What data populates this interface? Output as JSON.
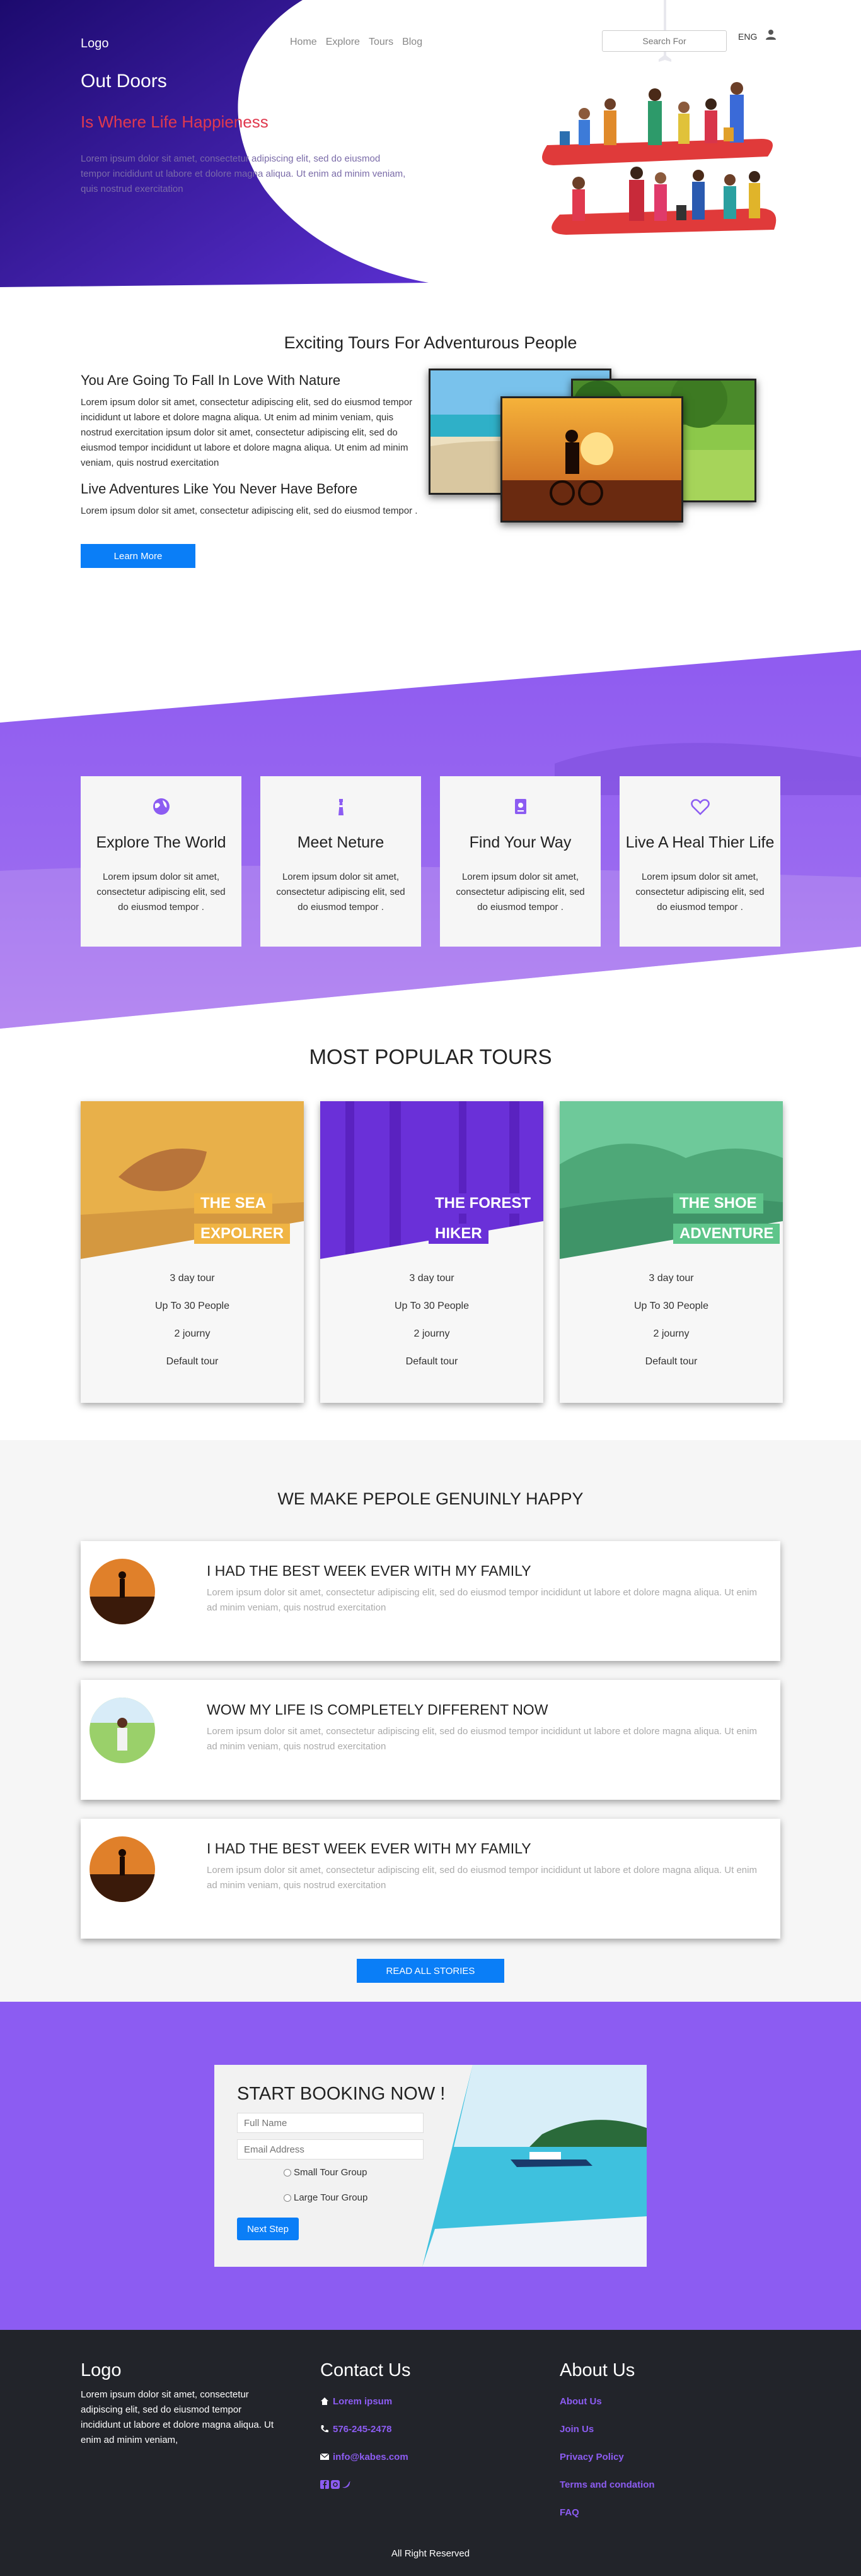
{
  "header": {
    "logo": "Logo",
    "nav": [
      "Home",
      "Explore",
      "Tours",
      "Blog"
    ],
    "search_placeholder": "Search For",
    "language": "ENG",
    "title": "Out Doors",
    "subtitle": "Is Where Life Happieness",
    "description": "Lorem ipsum dolor sit amet, consectetur adipiscing elit, sed do eiusmod tempor incididunt ut labore et dolore magna aliqua. Ut enim ad minim veniam, quis nostrud exercitation"
  },
  "about": {
    "heading": "Exciting Tours For Adventurous People",
    "h1": "You Are Going To Fall In Love With Nature",
    "p1": "Lorem ipsum dolor sit amet, consectetur adipiscing elit, sed do eiusmod tempor incididunt ut labore et dolore magna aliqua. Ut enim ad minim veniam, quis nostrud exercitation ipsum dolor sit amet, consectetur adipiscing elit, sed do eiusmod tempor incididunt ut labore et dolore magna aliqua. Ut enim ad minim veniam, quis nostrud exercitation",
    "h2": "Live Adventures Like You Never Have Before",
    "p2": "Lorem ipsum dolor sit amet, consectetur adipiscing elit, sed do eiusmod tempor .",
    "button": "Learn More"
  },
  "features": [
    {
      "icon": "globe-icon",
      "title": "Explore The World",
      "text": "Lorem ipsum dolor sit amet, consectetur adipiscing elit, sed do eiusmod tempor ."
    },
    {
      "icon": "lighthouse-icon",
      "title": "Meet Neture",
      "text": "Lorem ipsum dolor sit amet, consectetur adipiscing elit, sed do eiusmod tempor ."
    },
    {
      "icon": "map-book-icon",
      "title": "Find Your Way",
      "text": "Lorem ipsum dolor sit amet, consectetur adipiscing elit, sed do eiusmod tempor ."
    },
    {
      "icon": "heart-icon",
      "title": "Live A Heal Thier Life",
      "text": "Lorem ipsum dolor sit amet, consectetur adipiscing elit, sed do eiusmod tempor ."
    }
  ],
  "tours": {
    "heading": "MOST POPULAR TOURS",
    "items": [
      {
        "line1": "THE SEA",
        "line2": "EXPOLRER",
        "color": "#f0b443",
        "days": "3 day tour",
        "people": "Up To 30 People",
        "journey": "2 journy",
        "type": "Default tour"
      },
      {
        "line1": "THE FOREST",
        "line2": "HIKER",
        "color": "#6a30d8",
        "days": "3 day tour",
        "people": "Up To 30 People",
        "journey": "2 journy",
        "type": "Default tour"
      },
      {
        "line1": "THE SHOE",
        "line2": "ADVENTURE",
        "color": "#5ec58a",
        "days": "3 day tour",
        "people": "Up To 30 People",
        "journey": "2 journy",
        "type": "Default tour"
      }
    ]
  },
  "stories": {
    "heading": "WE MAKE PEPOLE GENUINLY HAPPY",
    "items": [
      {
        "title": "I HAD THE BEST WEEK EVER WITH MY FAMILY",
        "text": "Lorem ipsum dolor sit amet, consectetur adipiscing elit, sed do eiusmod tempor incididunt ut labore et dolore magna aliqua. Ut enim ad minim veniam, quis nostrud exercitation"
      },
      {
        "title": "WOW MY LIFE IS COMPLETELY DIFFERENT NOW",
        "text": "Lorem ipsum dolor sit amet, consectetur adipiscing elit, sed do eiusmod tempor incididunt ut labore et dolore magna aliqua. Ut enim ad minim veniam, quis nostrud exercitation"
      },
      {
        "title": "I HAD THE BEST WEEK EVER WITH MY FAMILY",
        "text": "Lorem ipsum dolor sit amet, consectetur adipiscing elit, sed do eiusmod tempor incididunt ut labore et dolore magna aliqua. Ut enim ad minim veniam, quis nostrud exercitation"
      }
    ],
    "button": "READ ALL STORIES"
  },
  "booking": {
    "title": "START BOOKING NOW !",
    "name_placeholder": "Full Name",
    "email_placeholder": "Email Address",
    "option1": "Small Tour Group",
    "option2": "Large Tour Group",
    "button": "Next Step"
  },
  "footer": {
    "logo": "Logo",
    "about_text": "Lorem ipsum dolor sit amet, consectetur adipiscing elit, sed do eiusmod tempor incididunt ut labore et dolore magna aliqua. Ut enim ad minim veniam,",
    "contact_title": "Contact Us",
    "contact_name": "Lorem ipsum",
    "phone": "576-245-2478",
    "email": "info@kabes.com",
    "about_title": "About Us",
    "links": [
      "About Us",
      "Join Us",
      "Privacy Policy",
      "Terms and condation",
      "FAQ"
    ],
    "copyright": "All Right Reserved"
  },
  "colors": {
    "primary": "#0a7ef7",
    "purple": "#8c5cf2",
    "navy": "#2a0f7a",
    "red": "#e0394e",
    "footer": "#22242a"
  }
}
